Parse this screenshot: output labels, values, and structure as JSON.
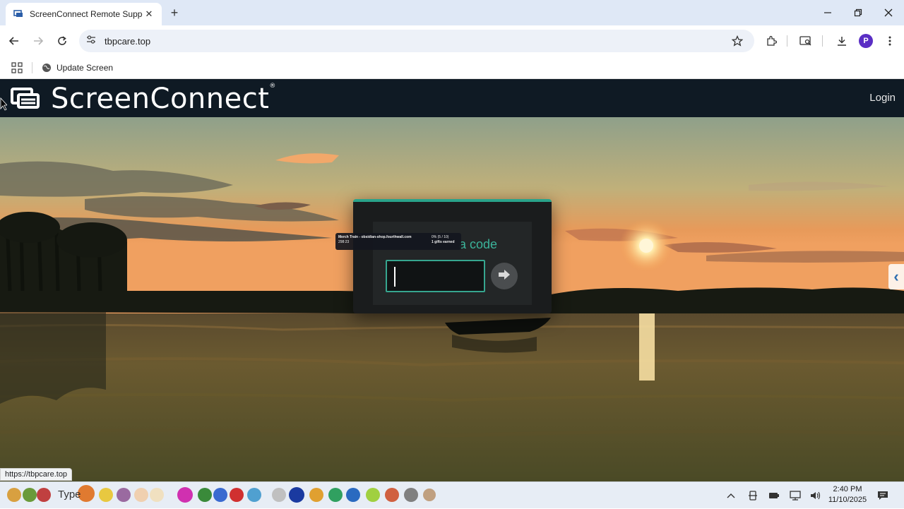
{
  "browser": {
    "tab": {
      "title": "ScreenConnect Remote Support",
      "favicon": "screenconnect-favicon"
    },
    "new_tab_label": "+",
    "window_controls": [
      "minimize",
      "restore",
      "close"
    ],
    "address": {
      "url": "tbpcare.top"
    },
    "profile_initial": "P",
    "bookmarks": [
      {
        "label": "Update Screen",
        "icon": "globe-icon"
      }
    ]
  },
  "page": {
    "brand": "ScreenConnect",
    "brand_mark": "®",
    "login_label": "Login",
    "modal": {
      "title_visible": "a code",
      "input_value": "",
      "submit_icon": "arrow-right-icon"
    },
    "overlay": {
      "line1": "Merch Train - obsidian-shop.fourthwall.com",
      "line2": "298:23",
      "right1": "0% (5 / 10)",
      "right2": "1 gifts earned"
    },
    "status_url": "https://tbpcare.top"
  },
  "taskbar": {
    "search_text": "Type",
    "clock_time": "2:40 PM",
    "clock_date": "11/10/2025"
  },
  "colors": {
    "header_bg": "#0f1a24",
    "accent": "#2aa38a",
    "tabstrip": "#dfe8f6"
  }
}
